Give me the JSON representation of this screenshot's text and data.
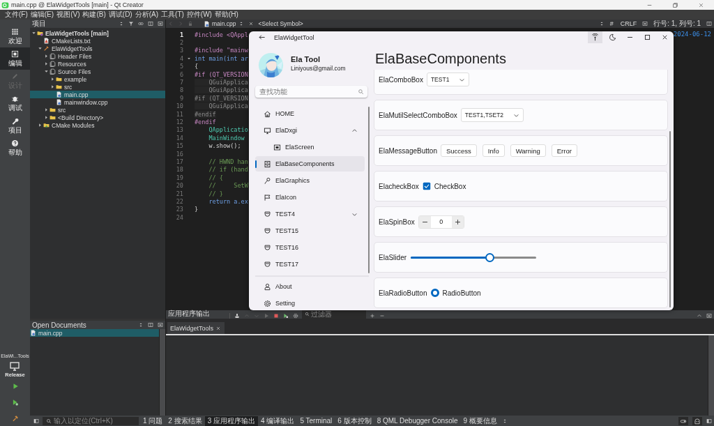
{
  "title_bar": {
    "title": "main.cpp @ ElaWidgetTools [main] - Qt Creator"
  },
  "menu": [
    "文件(F)",
    "编辑(E)",
    "视图(V)",
    "构建(B)",
    "调试(D)",
    "分析(A)",
    "工具(T)",
    "控件(W)",
    "帮助(H)"
  ],
  "mode_bar": [
    {
      "label": "欢迎",
      "selected": false,
      "disabled": false
    },
    {
      "label": "编辑",
      "selected": true,
      "disabled": false
    },
    {
      "label": "设计",
      "selected": false,
      "disabled": true
    },
    {
      "label": "调试",
      "selected": false,
      "disabled": false
    },
    {
      "label": "项目",
      "selected": false,
      "disabled": false
    },
    {
      "label": "帮助",
      "selected": false,
      "disabled": false
    }
  ],
  "kit": {
    "project": "ElaWi...Tools",
    "build": "Release"
  },
  "project_panel": {
    "title": "项目",
    "tree": [
      {
        "label": "ElaWidgetTools [main]",
        "kind": "project",
        "selected": false,
        "expanded": true,
        "children": [
          {
            "label": "CMakeLists.txt",
            "kind": "cmake",
            "selected": false
          },
          {
            "label": "ElaWidgetTools",
            "kind": "target",
            "selected": false,
            "expanded": true,
            "children": [
              {
                "label": "Header Files",
                "kind": "group",
                "selected": false,
                "expanded": false
              },
              {
                "label": "Resources",
                "kind": "group",
                "selected": false,
                "expanded": false
              },
              {
                "label": "Source Files",
                "kind": "group",
                "selected": false,
                "expanded": true,
                "children": [
                  {
                    "label": "example",
                    "kind": "folder",
                    "selected": false,
                    "expanded": false
                  },
                  {
                    "label": "src",
                    "kind": "folder",
                    "selected": false,
                    "expanded": false
                  },
                  {
                    "label": "main.cpp",
                    "kind": "cpp",
                    "selected": true
                  },
                  {
                    "label": "mainwindow.cpp",
                    "kind": "cpp",
                    "selected": false
                  }
                ]
              },
              {
                "label": "src",
                "kind": "folder",
                "selected": false,
                "expanded": false
              },
              {
                "label": "<Build Directory>",
                "kind": "folder",
                "selected": false,
                "expanded": false
              }
            ]
          },
          {
            "label": "CMake Modules",
            "kind": "cmakefolder",
            "selected": false,
            "expanded": false
          }
        ]
      }
    ]
  },
  "editor": {
    "file": "main.cpp",
    "symbol": "<Select Symbol>",
    "encoding_mark": "#",
    "line_ending": "CRLF",
    "position": "行号: 1, 列号: 1",
    "margin_text": "2024-06-12",
    "lines": [
      {
        "number": "1",
        "code": "#include <QAppl",
        "kind": "preprocessor",
        "current": true,
        "foldable": false
      },
      {
        "number": "2",
        "current": false,
        "foldable": false
      },
      {
        "number": "3",
        "code": "#include \"mainw",
        "kind": "preprocessor",
        "current": false,
        "foldable": false
      },
      {
        "number": "4",
        "code": "int main(int ar",
        "kind": "keyword",
        "current": false,
        "foldable": true
      },
      {
        "number": "5",
        "code": "{",
        "kind": "plain",
        "current": false,
        "foldable": false
      },
      {
        "number": "6",
        "code": "#if (QT_VERSION",
        "kind": "preprocessor",
        "current": false,
        "foldable": false
      },
      {
        "number": "7",
        "code": "    QGuiApplica",
        "kind": "inactive",
        "current": false,
        "foldable": false
      },
      {
        "number": "8",
        "code": "    QGuiApplica",
        "kind": "inactive",
        "current": false,
        "foldable": false
      },
      {
        "number": "9",
        "code": "#if (QT_VERSION",
        "kind": "inactive",
        "current": false,
        "foldable": false
      },
      {
        "number": "10",
        "code": "    QGuiApplica",
        "kind": "inactive",
        "current": false,
        "foldable": false
      },
      {
        "number": "11",
        "code": "#endif",
        "kind": "inactive",
        "current": false,
        "foldable": false
      },
      {
        "number": "12",
        "code": "#endif",
        "kind": "preprocessor",
        "current": false,
        "foldable": false
      },
      {
        "number": "13",
        "code": "    QApplicatio",
        "kind": "type",
        "current": false,
        "foldable": false
      },
      {
        "number": "14",
        "code": "    MainWindow",
        "kind": "type",
        "current": false,
        "foldable": false
      },
      {
        "number": "15",
        "code": "    w.show();",
        "kind": "plain",
        "current": false,
        "foldable": false
      },
      {
        "number": "16",
        "current": false,
        "foldable": false
      },
      {
        "number": "17",
        "code": "    // HWND han",
        "kind": "comment",
        "current": false,
        "foldable": false
      },
      {
        "number": "18",
        "code": "    // if (hand",
        "kind": "comment",
        "current": false,
        "foldable": false
      },
      {
        "number": "19",
        "code": "    // {",
        "kind": "comment",
        "current": false,
        "foldable": false
      },
      {
        "number": "20",
        "code": "    //     SetW",
        "kind": "comment",
        "current": false,
        "foldable": false
      },
      {
        "number": "21",
        "code": "    // }",
        "kind": "comment",
        "current": false,
        "foldable": false
      },
      {
        "number": "22",
        "code": "    return a.ex",
        "kind": "keyword",
        "current": false,
        "foldable": false
      },
      {
        "number": "23",
        "code": "}",
        "kind": "plain",
        "current": false,
        "foldable": false
      },
      {
        "number": "24",
        "current": false,
        "foldable": false
      }
    ]
  },
  "open_documents": {
    "title": "Open Documents",
    "items": [
      {
        "label": "main.cpp",
        "selected": true
      }
    ]
  },
  "output": {
    "title": "应用程序输出",
    "filter_placeholder": "过滤器",
    "tabs": [
      {
        "label": "ElaWidgetTools",
        "selected": true
      }
    ]
  },
  "status_bar": {
    "locator_placeholder": "输入以定位(Ctrl+K)",
    "panes": [
      {
        "label": "1 问题",
        "selected": false
      },
      {
        "label": "2 搜索结果",
        "selected": false
      },
      {
        "label": "3 应用程序输出",
        "selected": true
      },
      {
        "label": "4 编译输出",
        "selected": false
      },
      {
        "label": "5 Terminal",
        "selected": false
      },
      {
        "label": "6 版本控制",
        "selected": false
      },
      {
        "label": "8 QML Debugger Console",
        "selected": false
      },
      {
        "label": "9 概要信息",
        "selected": false
      }
    ]
  },
  "app": {
    "title": "ElaWidgetTool",
    "user": {
      "name": "Ela Tool",
      "email": "Liniyous@gmail.com"
    },
    "search_placeholder": "查找功能",
    "nav": [
      {
        "label": "HOME",
        "kind": "home",
        "selected": false
      },
      {
        "label": "ElaDxgi",
        "kind": "monitor",
        "selected": false,
        "expanded": true,
        "children": [
          {
            "label": "ElaScreen",
            "kind": "screen",
            "selected": false
          }
        ]
      },
      {
        "label": "ElaBaseComponents",
        "kind": "panel",
        "selected": true
      },
      {
        "label": "ElaGraphics",
        "kind": "key",
        "selected": false
      },
      {
        "label": "ElaIcon",
        "kind": "flag",
        "selected": false
      },
      {
        "label": "TEST4",
        "kind": "shield",
        "selected": false,
        "expanded": false
      },
      {
        "label": "TEST15",
        "kind": "shield",
        "selected": false
      },
      {
        "label": "TEST16",
        "kind": "shield",
        "selected": false
      },
      {
        "label": "TEST17",
        "kind": "shield",
        "selected": false
      }
    ],
    "footer_nav": [
      {
        "label": "About",
        "kind": "person",
        "selected": false
      },
      {
        "label": "Setting",
        "kind": "gear",
        "selected": false
      }
    ],
    "page_title": "ElaBaseComponents",
    "rows": [
      {
        "kind": "combo",
        "label": "ElaComboBox",
        "value": "TEST1"
      },
      {
        "kind": "combo",
        "label": "ElaMutilSelectComboBox",
        "value": "TEST1,TSET2"
      },
      {
        "kind": "buttons",
        "label": "ElaMessageButton",
        "buttons": [
          "Success",
          "Info",
          "Warning",
          "Error"
        ]
      },
      {
        "kind": "checkbox",
        "label": "ElacheckBox",
        "text": "CheckBox",
        "checked": true
      },
      {
        "kind": "spin",
        "label": "ElaSpinBox",
        "value": "0"
      },
      {
        "kind": "slider",
        "label": "ElaSlider",
        "level": 0.63
      },
      {
        "kind": "radio",
        "label": "ElaRadioButton",
        "text": "RadioButton",
        "selected": true
      }
    ]
  }
}
